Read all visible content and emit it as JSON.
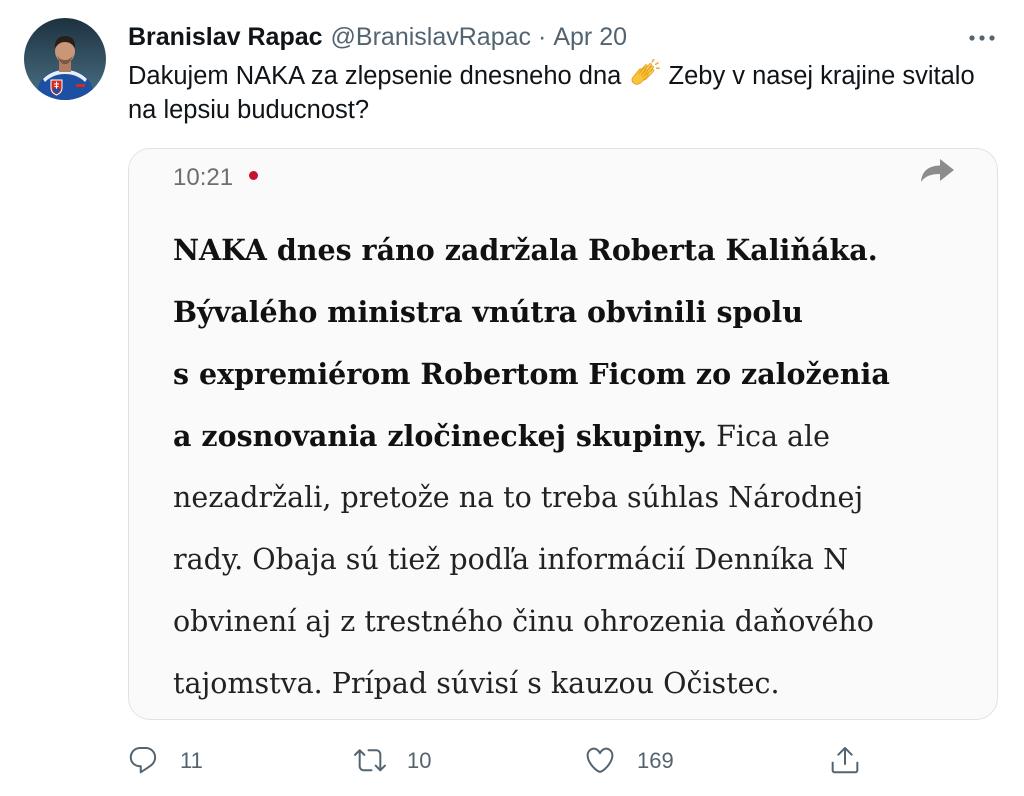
{
  "tweet": {
    "author_name": "Branislav Rapac",
    "handle": "@BranislavRapac",
    "separator": "·",
    "date": "Apr 20",
    "text_part1": "Dakujem NAKA za zlepsenie dnesneho dna",
    "emoji_icon": "clapping-hands-icon",
    "text_part2": "Zeby v nasej krajine svitalo",
    "text_part3": "na lepsiu buducnost?"
  },
  "icons": {
    "avatar": "profile-photo",
    "more": "more-horizontal-icon"
  },
  "card": {
    "time": "10:21",
    "live_dot_color": "#c41230",
    "share_icon": "share-arrow-icon",
    "article_lines": [
      {
        "bold": "NAKA dnes ráno zadržala Roberta Kaliňáka."
      },
      {
        "bold": "Bývalého ministra vnútra obvinili spolu"
      },
      {
        "bold": "s expremiérom Robertom Ficom zo založenia"
      },
      {
        "bold": "a zosnovania zločineckej skupiny.",
        "regular": "Fica ale"
      },
      {
        "regular": "nezadržali, pretože na to treba súhlas Národnej"
      },
      {
        "regular": "rady. Obaja sú tiež podľa informácií Denníka N"
      },
      {
        "regular": "obvinení aj z trestného činu ohrozenia daňového"
      },
      {
        "regular": "tajomstva. Prípad súvisí s kauzou Očistec."
      }
    ]
  },
  "actions": {
    "reply_icon": "reply-icon",
    "reply_count": "11",
    "retweet_icon": "retweet-icon",
    "retweet_count": "10",
    "like_icon": "heart-icon",
    "like_count": "169",
    "share_icon": "share-icon"
  },
  "colors": {
    "primary_text": "#0f1419",
    "secondary_text": "#536471",
    "card_border": "#dfe3e6",
    "card_background": "#fafafa",
    "emoji_yellow": "#f9c33a"
  }
}
